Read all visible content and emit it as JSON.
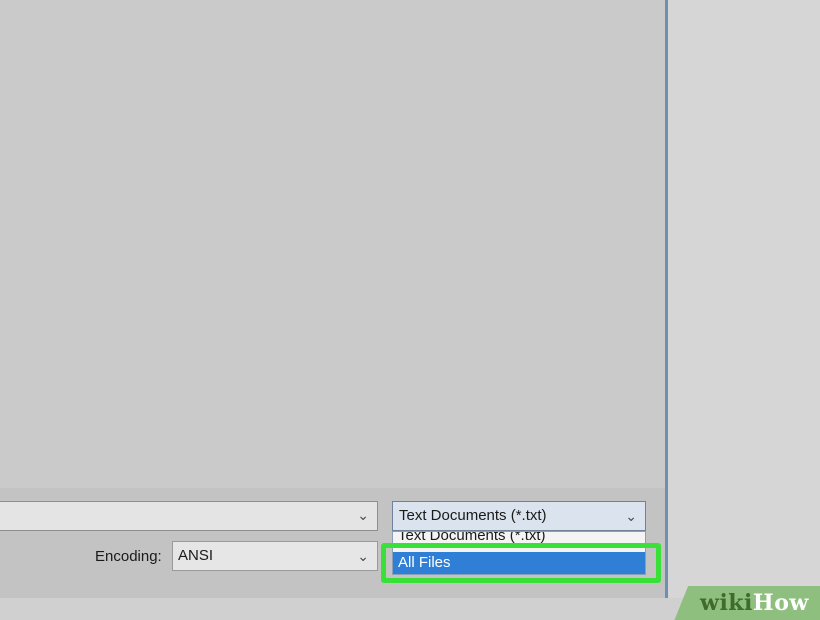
{
  "dialog": {
    "filename": {
      "value": ""
    },
    "file_type": {
      "selected": "Text Documents (*.txt)",
      "options": [
        "Text Documents (*.txt)",
        "All Files"
      ],
      "highlighted_option": "All Files"
    },
    "encoding": {
      "label": "Encoding:",
      "value": "ANSI"
    }
  },
  "highlight": {
    "color": "#38e038"
  },
  "watermark": {
    "part1": "wiki",
    "part2": "How"
  },
  "colors": {
    "selection_blue": "#2f7fd6",
    "window_border": "#6f8fb0"
  },
  "icons": {
    "dropdown": "chevron-down-icon"
  }
}
